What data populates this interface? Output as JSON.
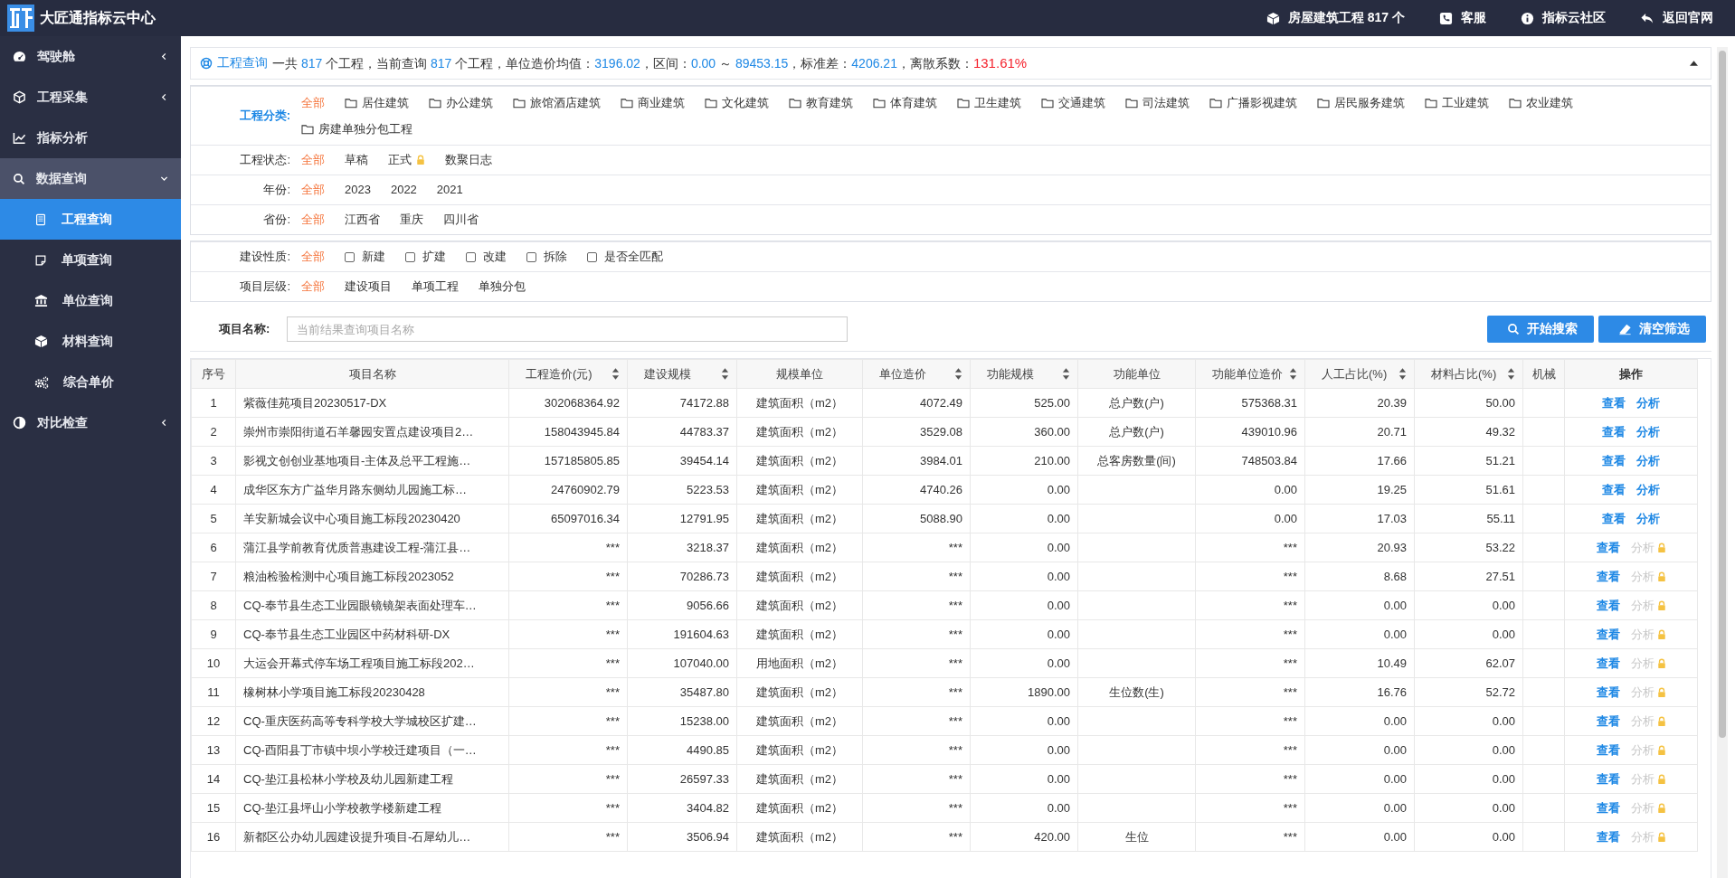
{
  "topbar": {
    "title": "大匠通指标云中心",
    "links": [
      {
        "label": "房屋建筑工程 817 个"
      },
      {
        "label": "客服"
      },
      {
        "label": "指标云社区"
      },
      {
        "label": "返回官网"
      }
    ]
  },
  "sidebar": {
    "items": [
      {
        "label": "驾驶舱",
        "selected": false,
        "expanded": false
      },
      {
        "label": "工程采集",
        "selected": false,
        "expanded": false
      },
      {
        "label": "指标分析",
        "selected": false
      },
      {
        "label": "数据查询",
        "selected": false,
        "expanded": true,
        "children": [
          {
            "label": "工程查询",
            "selected": true
          },
          {
            "label": "单项查询",
            "selected": false
          },
          {
            "label": "单位查询",
            "selected": false
          },
          {
            "label": "材料查询",
            "selected": false
          },
          {
            "label": "综合单价",
            "selected": false
          }
        ]
      },
      {
        "label": "对比检查",
        "selected": false,
        "expanded": false
      }
    ]
  },
  "summary": {
    "title": "工程查询",
    "expanded": true,
    "segments": [
      {
        "text": "一共 ",
        "kind": "plain"
      },
      {
        "text": "817",
        "kind": "value"
      },
      {
        "text": " 个工程，当前查询 ",
        "kind": "plain"
      },
      {
        "text": "817",
        "kind": "value"
      },
      {
        "text": " 个工程，单位造价均值：",
        "kind": "plain"
      },
      {
        "text": "3196.02",
        "kind": "value"
      },
      {
        "text": "，区间：",
        "kind": "plain"
      },
      {
        "text": "0.00",
        "kind": "value"
      },
      {
        "text": " ～ ",
        "kind": "plain"
      },
      {
        "text": "89453.15",
        "kind": "value"
      },
      {
        "text": "，标准差：",
        "kind": "plain"
      },
      {
        "text": "4206.21",
        "kind": "value"
      },
      {
        "text": "，离散系数：",
        "kind": "plain"
      },
      {
        "text": "131.61%",
        "kind": "alert"
      }
    ]
  },
  "filters": [
    {
      "groups": [
        {
          "label": "工程分类:",
          "active": true,
          "options": [
            {
              "label": "全部",
              "kind": "text",
              "selected": true
            },
            {
              "label": "居住建筑",
              "kind": "folder",
              "selected": false
            },
            {
              "label": "办公建筑",
              "kind": "folder",
              "selected": false
            },
            {
              "label": "旅馆酒店建筑",
              "kind": "folder",
              "selected": false
            },
            {
              "label": "商业建筑",
              "kind": "folder",
              "selected": false
            },
            {
              "label": "文化建筑",
              "kind": "folder",
              "selected": false
            },
            {
              "label": "教育建筑",
              "kind": "folder",
              "selected": false
            },
            {
              "label": "体育建筑",
              "kind": "folder",
              "selected": false
            },
            {
              "label": "卫生建筑",
              "kind": "folder",
              "selected": false
            },
            {
              "label": "交通建筑",
              "kind": "folder",
              "selected": false
            },
            {
              "label": "司法建筑",
              "kind": "folder",
              "selected": false
            },
            {
              "label": "广播影视建筑",
              "kind": "folder",
              "selected": false
            },
            {
              "label": "居民服务建筑",
              "kind": "folder",
              "selected": false
            },
            {
              "label": "工业建筑",
              "kind": "folder",
              "selected": false
            },
            {
              "label": "农业建筑",
              "kind": "folder",
              "selected": false
            },
            {
              "label": "房建单独分包工程",
              "kind": "folder",
              "selected": false
            }
          ]
        },
        {
          "label": "工程状态:",
          "active": false,
          "options": [
            {
              "label": "全部",
              "kind": "text",
              "selected": true
            },
            {
              "label": "草稿",
              "kind": "text",
              "selected": false
            },
            {
              "label": "正式",
              "kind": "locked",
              "selected": false
            },
            {
              "label": "数聚日志",
              "kind": "text",
              "selected": false
            }
          ]
        },
        {
          "label": "年份:",
          "active": false,
          "options": [
            {
              "label": "全部",
              "kind": "text",
              "selected": true
            },
            {
              "label": "2023",
              "kind": "text",
              "selected": false
            },
            {
              "label": "2022",
              "kind": "text",
              "selected": false
            },
            {
              "label": "2021",
              "kind": "text",
              "selected": false
            }
          ]
        },
        {
          "label": "省份:",
          "active": false,
          "options": [
            {
              "label": "全部",
              "kind": "text",
              "selected": true
            },
            {
              "label": "江西省",
              "kind": "text",
              "selected": false
            },
            {
              "label": "重庆",
              "kind": "text",
              "selected": false
            },
            {
              "label": "四川省",
              "kind": "text",
              "selected": false
            }
          ]
        }
      ]
    },
    {
      "groups": [
        {
          "label": "建设性质:",
          "active": false,
          "options": [
            {
              "label": "全部",
              "kind": "text",
              "selected": true
            },
            {
              "label": "新建",
              "kind": "checkbox",
              "selected": false,
              "checked": false
            },
            {
              "label": "扩建",
              "kind": "checkbox",
              "selected": false,
              "checked": false
            },
            {
              "label": "改建",
              "kind": "checkbox",
              "selected": false,
              "checked": false
            },
            {
              "label": "拆除",
              "kind": "checkbox",
              "selected": false,
              "checked": false
            },
            {
              "label": "是否全匹配",
              "kind": "checkbox",
              "selected": false,
              "checked": false
            }
          ]
        },
        {
          "label": "项目层级:",
          "active": false,
          "options": [
            {
              "label": "全部",
              "kind": "text",
              "selected": true
            },
            {
              "label": "建设项目",
              "kind": "text",
              "selected": false
            },
            {
              "label": "单项工程",
              "kind": "text",
              "selected": false
            },
            {
              "label": "单独分包",
              "kind": "text",
              "selected": false
            }
          ]
        }
      ]
    }
  ],
  "search": {
    "label": "项目名称:",
    "placeholder": "当前结果查询项目名称",
    "buttons": [
      {
        "label": "开始搜索"
      },
      {
        "label": "清空筛选"
      }
    ]
  },
  "table": {
    "columns": [
      {
        "label": "序号",
        "sortable": false
      },
      {
        "label": "项目名称",
        "sortable": false
      },
      {
        "label": "工程造价(元)",
        "sortable": true
      },
      {
        "label": "建设规模",
        "sortable": true
      },
      {
        "label": "规模单位",
        "sortable": false
      },
      {
        "label": "单位造价",
        "sortable": true
      },
      {
        "label": "功能规模",
        "sortable": true
      },
      {
        "label": "功能单位",
        "sortable": false
      },
      {
        "label": "功能单位造价",
        "sortable": true
      },
      {
        "label": "人工占比(%)",
        "sortable": true
      },
      {
        "label": "材料占比(%)",
        "sortable": true
      },
      {
        "label": "机械",
        "sortable": false
      },
      {
        "label": "操作",
        "sortable": false
      }
    ],
    "rows": [
      {
        "no": "1",
        "name": "紫薇佳苑项目20230517-DX",
        "cost": "302068364.92",
        "scale": "74172.88",
        "scale_unit": "建筑面积（m2）",
        "unit_cost": "4072.49",
        "func_scale": "525.00",
        "func_unit": "总户数(户)",
        "func_unit_cost": "575368.31",
        "labor_pct": "20.39",
        "material_pct": "50.00",
        "view": "查看",
        "analyze": "分析",
        "analyze_locked": false
      },
      {
        "no": "2",
        "name": "崇州市崇阳街道石羊馨园安置点建设项目2…",
        "cost": "158043945.84",
        "scale": "44783.37",
        "scale_unit": "建筑面积（m2）",
        "unit_cost": "3529.08",
        "func_scale": "360.00",
        "func_unit": "总户数(户)",
        "func_unit_cost": "439010.96",
        "labor_pct": "20.71",
        "material_pct": "49.32",
        "view": "查看",
        "analyze": "分析",
        "analyze_locked": false
      },
      {
        "no": "3",
        "name": "影视文创创业基地项目-主体及总平工程施…",
        "cost": "157185805.85",
        "scale": "39454.14",
        "scale_unit": "建筑面积（m2）",
        "unit_cost": "3984.01",
        "func_scale": "210.00",
        "func_unit": "总客房数量(间)",
        "func_unit_cost": "748503.84",
        "labor_pct": "17.66",
        "material_pct": "51.21",
        "view": "查看",
        "analyze": "分析",
        "analyze_locked": false
      },
      {
        "no": "4",
        "name": "成华区东方广益华月路东侧幼儿园施工标…",
        "cost": "24760902.79",
        "scale": "5223.53",
        "scale_unit": "建筑面积（m2）",
        "unit_cost": "4740.26",
        "func_scale": "0.00",
        "func_unit_cost": "0.00",
        "labor_pct": "19.25",
        "material_pct": "51.61",
        "view": "查看",
        "analyze": "分析",
        "analyze_locked": false
      },
      {
        "no": "5",
        "name": "羊安新城会议中心项目施工标段20230420",
        "cost": "65097016.34",
        "scale": "12791.95",
        "scale_unit": "建筑面积（m2）",
        "unit_cost": "5088.90",
        "func_scale": "0.00",
        "func_unit_cost": "0.00",
        "labor_pct": "17.03",
        "material_pct": "55.11",
        "view": "查看",
        "analyze": "分析",
        "analyze_locked": false
      },
      {
        "no": "6",
        "name": "蒲江县学前教育优质普惠建设工程-蒲江县…",
        "cost": "***",
        "scale": "3218.37",
        "scale_unit": "建筑面积（m2）",
        "unit_cost": "***",
        "func_scale": "0.00",
        "func_unit_cost": "***",
        "labor_pct": "20.93",
        "material_pct": "53.22",
        "view": "查看",
        "analyze": "分析",
        "analyze_locked": true
      },
      {
        "no": "7",
        "name": "粮油检验检测中心项目施工标段2023052",
        "cost": "***",
        "scale": "70286.73",
        "scale_unit": "建筑面积（m2）",
        "unit_cost": "***",
        "func_scale": "0.00",
        "func_unit_cost": "***",
        "labor_pct": "8.68",
        "material_pct": "27.51",
        "view": "查看",
        "analyze": "分析",
        "analyze_locked": true
      },
      {
        "no": "8",
        "name": "CQ-奉节县生态工业园眼镜镜架表面处理车…",
        "cost": "***",
        "scale": "9056.66",
        "scale_unit": "建筑面积（m2）",
        "unit_cost": "***",
        "func_scale": "0.00",
        "func_unit_cost": "***",
        "labor_pct": "0.00",
        "material_pct": "0.00",
        "view": "查看",
        "analyze": "分析",
        "analyze_locked": true
      },
      {
        "no": "9",
        "name": "CQ-奉节县生态工业园区中药材科研-DX",
        "cost": "***",
        "scale": "191604.63",
        "scale_unit": "建筑面积（m2）",
        "unit_cost": "***",
        "func_scale": "0.00",
        "func_unit_cost": "***",
        "labor_pct": "0.00",
        "material_pct": "0.00",
        "view": "查看",
        "analyze": "分析",
        "analyze_locked": true
      },
      {
        "no": "10",
        "name": "大运会开幕式停车场工程项目施工标段202…",
        "cost": "***",
        "scale": "107040.00",
        "scale_unit": "用地面积（m2）",
        "unit_cost": "***",
        "func_scale": "0.00",
        "func_unit_cost": "***",
        "labor_pct": "10.49",
        "material_pct": "62.07",
        "view": "查看",
        "analyze": "分析",
        "analyze_locked": true
      },
      {
        "no": "11",
        "name": "橡树林小学项目施工标段20230428",
        "cost": "***",
        "scale": "35487.80",
        "scale_unit": "建筑面积（m2）",
        "unit_cost": "***",
        "func_scale": "1890.00",
        "func_unit": "生位数(生)",
        "func_unit_cost": "***",
        "labor_pct": "16.76",
        "material_pct": "52.72",
        "view": "查看",
        "analyze": "分析",
        "analyze_locked": true
      },
      {
        "no": "12",
        "name": "CQ-重庆医药高等专科学校大学城校区扩建…",
        "cost": "***",
        "scale": "15238.00",
        "scale_unit": "建筑面积（m2）",
        "unit_cost": "***",
        "func_scale": "0.00",
        "func_unit_cost": "***",
        "labor_pct": "0.00",
        "material_pct": "0.00",
        "view": "查看",
        "analyze": "分析",
        "analyze_locked": true
      },
      {
        "no": "13",
        "name": "CQ-酉阳县丁市镇中坝小学校迁建项目（一…",
        "cost": "***",
        "scale": "4490.85",
        "scale_unit": "建筑面积（m2）",
        "unit_cost": "***",
        "func_scale": "0.00",
        "func_unit_cost": "***",
        "labor_pct": "0.00",
        "material_pct": "0.00",
        "view": "查看",
        "analyze": "分析",
        "analyze_locked": true
      },
      {
        "no": "14",
        "name": "CQ-垫江县松林小学校及幼儿园新建工程",
        "cost": "***",
        "scale": "26597.33",
        "scale_unit": "建筑面积（m2）",
        "unit_cost": "***",
        "func_scale": "0.00",
        "func_unit_cost": "***",
        "labor_pct": "0.00",
        "material_pct": "0.00",
        "view": "查看",
        "analyze": "分析",
        "analyze_locked": true
      },
      {
        "no": "15",
        "name": "CQ-垫江县坪山小学校教学楼新建工程",
        "cost": "***",
        "scale": "3404.82",
        "scale_unit": "建筑面积（m2）",
        "unit_cost": "***",
        "func_scale": "0.00",
        "func_unit_cost": "***",
        "labor_pct": "0.00",
        "material_pct": "0.00",
        "view": "查看",
        "analyze": "分析",
        "analyze_locked": true
      },
      {
        "no": "16",
        "name": "新都区公办幼儿园建设提升项目-石犀幼儿…",
        "cost": "***",
        "scale": "3506.94",
        "scale_unit": "建筑面积（m2）",
        "unit_cost": "***",
        "func_scale": "420.00",
        "func_unit": "生位",
        "func_unit_cost": "***",
        "labor_pct": "0.00",
        "material_pct": "0.00",
        "view": "查看",
        "analyze": "分析",
        "analyze_locked": true
      }
    ]
  }
}
